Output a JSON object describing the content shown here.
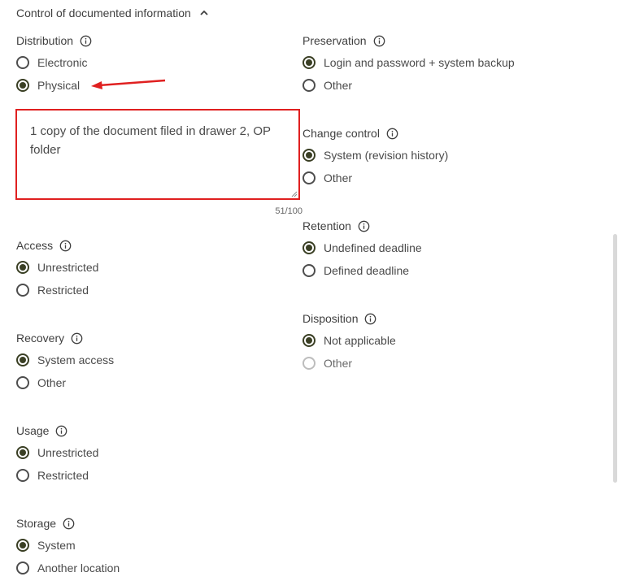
{
  "section": {
    "title": "Control of documented information"
  },
  "colors": {
    "accent": "#3a3f24",
    "highlight": "#e02020"
  },
  "distribution": {
    "title": "Distribution",
    "options": [
      {
        "label": "Electronic",
        "checked": false
      },
      {
        "label": "Physical",
        "checked": true
      }
    ]
  },
  "note": {
    "value": "1 copy of the document filed in drawer 2, OP folder",
    "counter": "51/100"
  },
  "access": {
    "title": "Access",
    "options": [
      {
        "label": "Unrestricted",
        "checked": true
      },
      {
        "label": "Restricted",
        "checked": false
      }
    ]
  },
  "recovery": {
    "title": "Recovery",
    "options": [
      {
        "label": "System access",
        "checked": true
      },
      {
        "label": "Other",
        "checked": false
      }
    ]
  },
  "usage": {
    "title": "Usage",
    "options": [
      {
        "label": "Unrestricted",
        "checked": true
      },
      {
        "label": "Restricted",
        "checked": false
      }
    ]
  },
  "storage": {
    "title": "Storage",
    "options": [
      {
        "label": "System",
        "checked": true
      },
      {
        "label": "Another location",
        "checked": false
      }
    ]
  },
  "preservation": {
    "title": "Preservation",
    "options": [
      {
        "label": "Login and password + system backup",
        "checked": true
      },
      {
        "label": "Other",
        "checked": false
      }
    ]
  },
  "change_control": {
    "title": "Change control",
    "options": [
      {
        "label": "System (revision history)",
        "checked": true
      },
      {
        "label": "Other",
        "checked": false
      }
    ]
  },
  "retention": {
    "title": "Retention",
    "options": [
      {
        "label": "Undefined deadline",
        "checked": true
      },
      {
        "label": "Defined deadline",
        "checked": false
      }
    ]
  },
  "disposition": {
    "title": "Disposition",
    "options": [
      {
        "label": "Not applicable",
        "checked": true
      },
      {
        "label": "Other",
        "checked": false,
        "disabled": true
      }
    ]
  }
}
